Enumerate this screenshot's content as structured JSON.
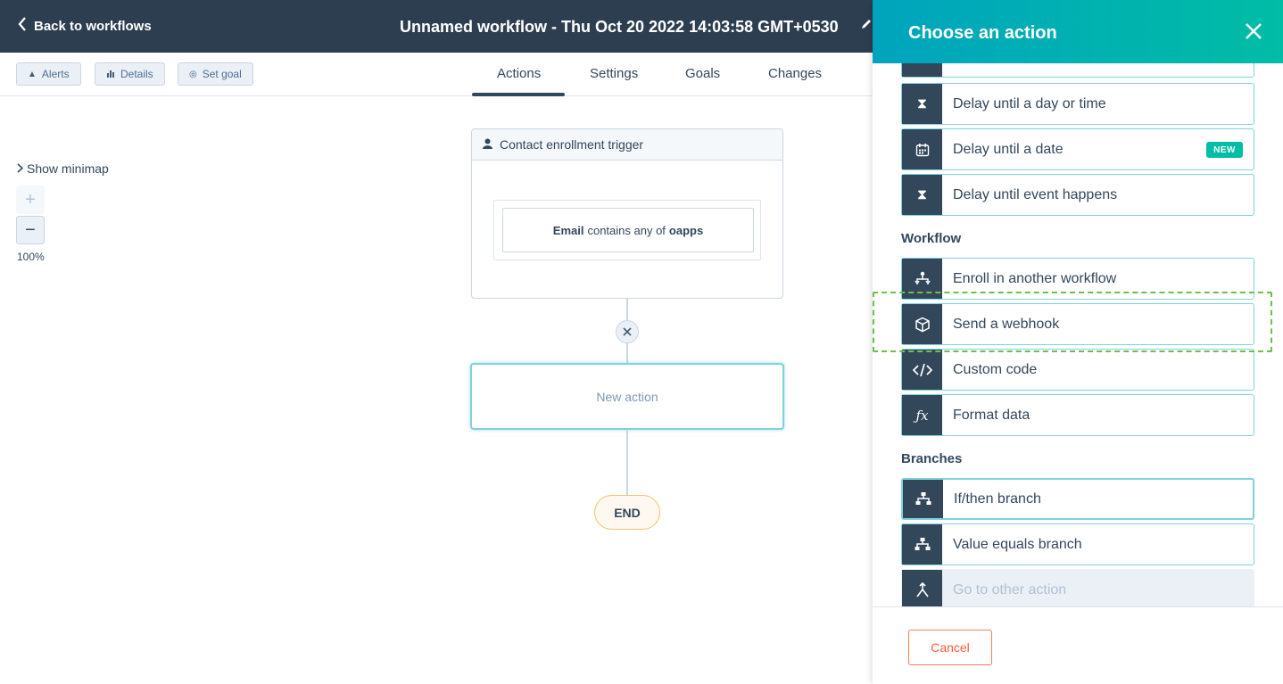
{
  "header": {
    "back_label": "Back to workflows",
    "title": "Unnamed workflow - Thu Oct 20 2022 14:03:58 GMT+0530"
  },
  "toolbar": {
    "alerts_label": "Alerts",
    "details_label": "Details",
    "set_goal_label": "Set goal"
  },
  "tabs": [
    {
      "label": "Actions",
      "active": true
    },
    {
      "label": "Settings"
    },
    {
      "label": "Goals"
    },
    {
      "label": "Changes"
    }
  ],
  "canvas": {
    "minimap_label": "Show minimap",
    "zoom_plus": "+",
    "zoom_minus": "−",
    "zoom_level": "100%",
    "trigger_title": "Contact enrollment trigger",
    "filter_property": "Email",
    "filter_operator": "contains any of",
    "filter_value": "oapps",
    "new_action_label": "New action",
    "end_label": "END"
  },
  "panel": {
    "title": "Choose an action",
    "sections": {
      "workflow": "Workflow",
      "branches": "Branches"
    },
    "actions": {
      "delay_day_time": "Delay until a day or time",
      "delay_date": "Delay until a date",
      "delay_event": "Delay until event happens",
      "enroll_workflow": "Enroll in another workflow",
      "send_webhook": "Send a webhook",
      "custom_code": "Custom code",
      "format_data": "Format data",
      "if_then": "If/then branch",
      "value_equals": "Value equals branch",
      "go_to_other": "Go to other action"
    },
    "new_badge": "NEW",
    "cancel_label": "Cancel"
  },
  "colors": {
    "header_bg": "#2d3e50",
    "panel_gradient_start": "#00a4bd",
    "panel_gradient_end": "#00bda5",
    "highlight": "#6cc04a",
    "cancel": "#ff5c35"
  }
}
